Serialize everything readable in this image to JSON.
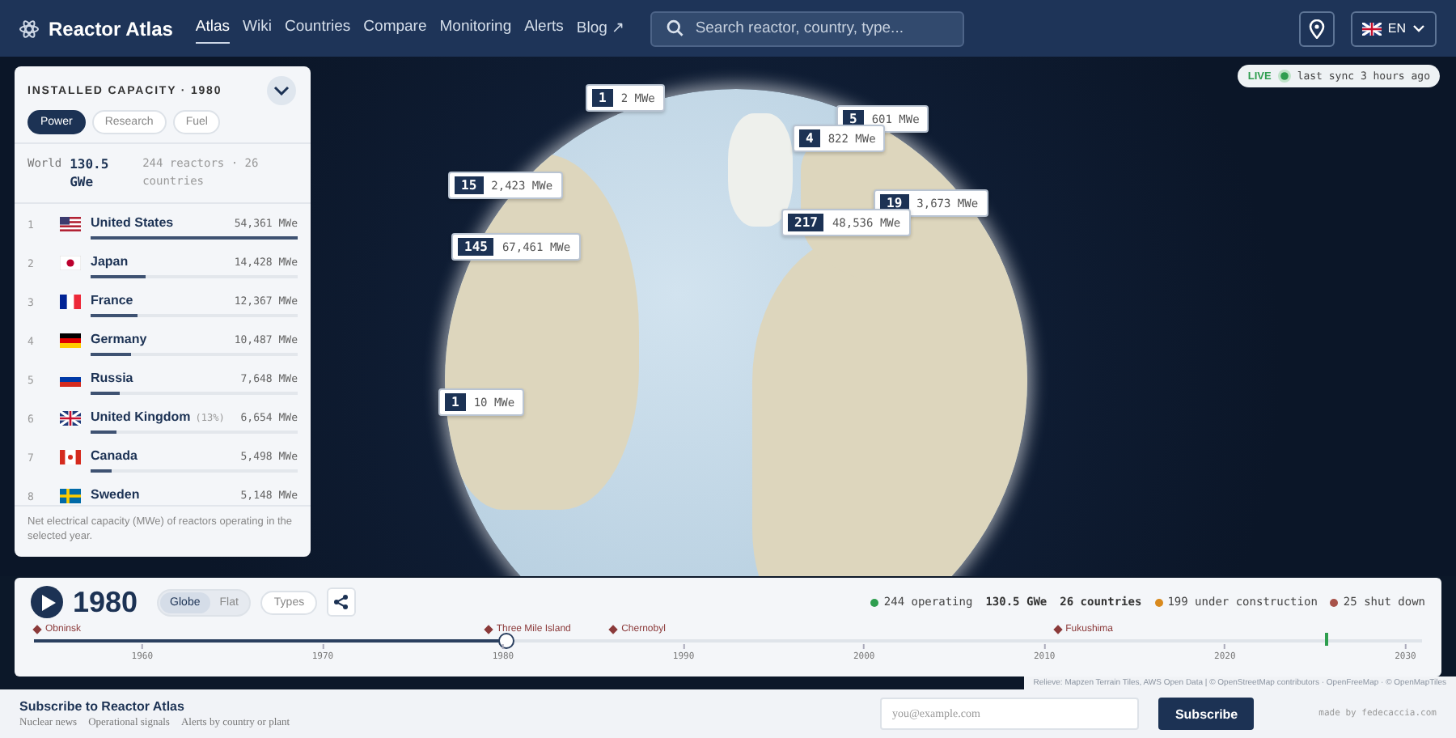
{
  "header": {
    "brand": "Reactor Atlas",
    "nav": [
      {
        "label": "Atlas",
        "selected": true
      },
      {
        "label": "Wiki",
        "selected": false
      },
      {
        "label": "Countries",
        "selected": false
      },
      {
        "label": "Compare",
        "selected": false
      },
      {
        "label": "Monitoring",
        "selected": false
      },
      {
        "label": "Alerts",
        "selected": false
      },
      {
        "label": "Blog ↗",
        "selected": false
      }
    ],
    "search": {
      "placeholder": "Search reactor, country, type..."
    },
    "language": "EN"
  },
  "panel": {
    "title": "INSTALLED CAPACITY · 1980",
    "filters": [
      {
        "label": "Power",
        "selected": true
      },
      {
        "label": "Research",
        "selected": false
      },
      {
        "label": "Fuel",
        "selected": false
      }
    ],
    "world_label": "World",
    "world_value": "130.5 GWe",
    "world_detail": "244 reactors · 26 countries",
    "rows": [
      {
        "rank": "1",
        "kind": "us",
        "name": "United States",
        "value": "54,361 MWe",
        "level": 1
      },
      {
        "rank": "2",
        "kind": "jp",
        "name": "Japan",
        "value": "14,428 MWe",
        "level": 0.265
      },
      {
        "rank": "3",
        "kind": "fr",
        "name": "France",
        "value": "12,367 MWe",
        "level": 0.227
      },
      {
        "rank": "4",
        "kind": "de",
        "name": "Germany",
        "value": "10,487 MWe",
        "level": 0.193
      },
      {
        "rank": "5",
        "kind": "ru",
        "name": "Russia",
        "value": "7,648 MWe",
        "level": 0.141
      },
      {
        "rank": "6",
        "kind": "gb",
        "name": "United Kingdom",
        "note": "(13%)",
        "value": "6,654 MWe",
        "level": 0.122
      },
      {
        "rank": "7",
        "kind": "ca",
        "name": "Canada",
        "value": "5,498 MWe",
        "level": 0.101
      },
      {
        "rank": "8",
        "kind": "se",
        "name": "Sweden",
        "value": "5,148 MWe"
      }
    ],
    "footnote": "Net electrical capacity (MWe) of reactors operating in the selected year."
  },
  "live": {
    "badge": "LIVE",
    "text": "last sync 3 hours ago"
  },
  "markers": [
    {
      "count": "1",
      "value": "2 MWe"
    },
    {
      "count": "5",
      "value": "601 MWe"
    },
    {
      "count": "4",
      "value": "822 MWe"
    },
    {
      "count": "15",
      "value": "2,423 MWe"
    },
    {
      "count": "19",
      "value": "3,673 MWe"
    },
    {
      "count": "217",
      "value": "48,536 MWe"
    },
    {
      "count": "145",
      "value": "67,461 MWe"
    },
    {
      "count": "1",
      "value": "10 MWe"
    }
  ],
  "timeline": {
    "year": "1980",
    "views": [
      {
        "label": "Globe",
        "selected": true
      },
      {
        "label": "Flat",
        "selected": false
      }
    ],
    "types": "Types",
    "stats": [
      {
        "kind": "dot",
        "color": "#2e9e4f",
        "text": "244 operating"
      },
      {
        "kind": "plain",
        "text": "130.5 GWe"
      },
      {
        "kind": "plain",
        "text": "26 countries"
      },
      {
        "kind": "dot",
        "color": "#d98a1e",
        "text": "199 under construction"
      },
      {
        "kind": "dot",
        "color": "#a8524a",
        "text": "25 shut down"
      }
    ],
    "events": [
      "Obninsk",
      "Three Mile Island",
      "Chernobyl",
      "Fukushima"
    ],
    "level": 0.34,
    "ticks": [
      "1960",
      "1970",
      "1980",
      "1990",
      "2000",
      "2010",
      "2020",
      "2030"
    ]
  },
  "attribution": "Relieve: Mapzen Terrain Tiles, AWS Open Data | © OpenStreetMap contributors · OpenFreeMap · © OpenMapTiles",
  "footer": {
    "title": "Subscribe to Reactor Atlas",
    "tags": [
      "Nuclear news",
      "Operational signals",
      "Alerts by country or plant"
    ],
    "email_placeholder": "you@example.com",
    "button": "Subscribe",
    "credit": "made by fedecaccia.com"
  }
}
